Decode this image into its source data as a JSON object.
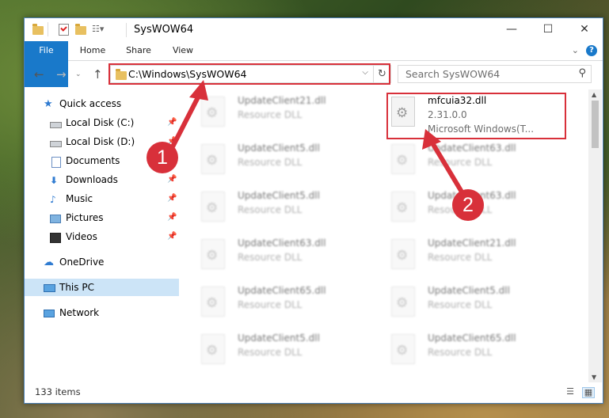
{
  "window": {
    "title": "SysWOW64",
    "minimize_glyph": "—",
    "maximize_glyph": "☐",
    "close_glyph": "✕"
  },
  "ribbon": {
    "tabs": [
      "File",
      "Home",
      "Share",
      "View"
    ],
    "help_glyph": "?"
  },
  "navigation": {
    "back_glyph": "←",
    "forward_glyph": "→",
    "up_glyph": "↑",
    "address_path": "C:\\Windows\\SysWOW64",
    "dropdown_glyph": "⌵",
    "refresh_glyph": "↻",
    "search_placeholder": "Search SysWOW64",
    "search_glyph": "⚲"
  },
  "sidebar": {
    "items": [
      {
        "label": "Quick access",
        "icon": "star-icon",
        "pinned": false
      },
      {
        "label": "Local Disk (C:)",
        "icon": "drive-icon",
        "pinned": true
      },
      {
        "label": "Local Disk (D:)",
        "icon": "drive-icon",
        "pinned": true
      },
      {
        "label": "Documents",
        "icon": "document-icon",
        "pinned": true
      },
      {
        "label": "Downloads",
        "icon": "download-icon",
        "pinned": true
      },
      {
        "label": "Music",
        "icon": "music-icon",
        "pinned": true
      },
      {
        "label": "Pictures",
        "icon": "pictures-icon",
        "pinned": true
      },
      {
        "label": "Videos",
        "icon": "video-icon",
        "pinned": true
      },
      {
        "label": "OneDrive",
        "icon": "cloud-icon",
        "pinned": false
      },
      {
        "label": "This PC",
        "icon": "computer-icon",
        "pinned": false,
        "selected": true
      },
      {
        "label": "Network",
        "icon": "network-icon",
        "pinned": false
      }
    ]
  },
  "files": [
    {
      "name": "UpdateClient21.dll",
      "type": "Resource DLL"
    },
    {
      "name": "mfcuia32.dll",
      "version": "2.31.0.0",
      "company": "Microsoft Windows(T..."
    },
    {
      "name": "UpdateClient5.dll",
      "type": "Resource DLL"
    },
    {
      "name": "UpdateClient63.dll",
      "type": "Resource DLL"
    },
    {
      "name": "UpdateClient5.dll",
      "type": "Resource DLL"
    },
    {
      "name": "UpdateClient63.dll",
      "type": "Resource DLL"
    },
    {
      "name": "UpdateClient63.dll",
      "type": "Resource DLL"
    },
    {
      "name": "UpdateClient21.dll",
      "type": "Resource DLL"
    },
    {
      "name": "UpdateClient65.dll",
      "type": "Resource DLL"
    },
    {
      "name": "UpdateClient5.dll",
      "type": "Resource DLL"
    },
    {
      "name": "UpdateClient5.dll",
      "type": "Resource DLL"
    },
    {
      "name": "UpdateClient65.dll",
      "type": "Resource DLL"
    }
  ],
  "status": {
    "item_count": "133 items"
  },
  "annotations": {
    "callout_1": "1",
    "callout_2": "2",
    "color": "#d8303a"
  }
}
